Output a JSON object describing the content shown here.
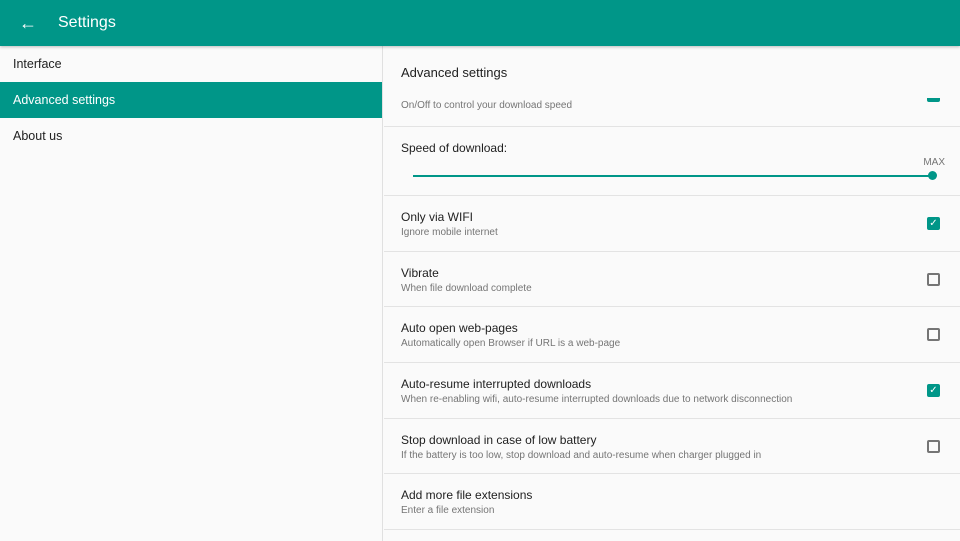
{
  "header": {
    "title": "Settings",
    "back_icon": "arrow-left-icon"
  },
  "sidebar": {
    "items": [
      {
        "label": "Interface"
      },
      {
        "label": "Advanced settings"
      },
      {
        "label": "About us"
      }
    ]
  },
  "main": {
    "section_title": "Advanced settings",
    "partial_row": {
      "subtitle": "On/Off to control your download speed",
      "checked": true
    },
    "speed": {
      "label": "Speed of download:",
      "value_label": "MAX",
      "value_fraction": 1.0
    },
    "rows": [
      {
        "title": "Only via WIFI",
        "subtitle": "Ignore mobile internet",
        "checked": true
      },
      {
        "title": "Vibrate",
        "subtitle": "When file download complete",
        "checked": false
      },
      {
        "title": "Auto open web-pages",
        "subtitle": "Automatically open Browser if URL is a web-page",
        "checked": false
      },
      {
        "title": "Auto-resume interrupted downloads",
        "subtitle": "When re-enabling wifi, auto-resume interrupted downloads due to network disconnection",
        "checked": true
      },
      {
        "title": "Stop download in case of low battery",
        "subtitle": "If the battery is too low, stop download and auto-resume when charger plugged in",
        "checked": false
      },
      {
        "title": "Add more file extensions",
        "subtitle": "Enter a file extension",
        "checked": null
      }
    ]
  },
  "colors": {
    "accent": "#009688"
  }
}
